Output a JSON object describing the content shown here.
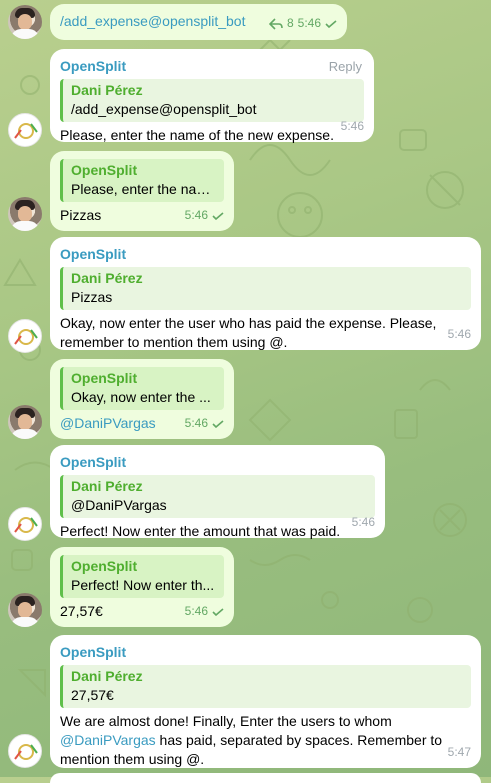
{
  "colors": {
    "background": "#a9c785",
    "outgoing_bubble": "#effdde",
    "incoming_bubble": "#ffffff",
    "sender_name": "#3a9bc0",
    "quote_bar": "#5fbf4a",
    "status_green": "#63a864"
  },
  "messages": [
    {
      "type": "outgoing",
      "text": "/add_expense@opensplit_bot",
      "reply_count": "8",
      "time": "5:46"
    },
    {
      "type": "incoming",
      "sender": "OpenSplit",
      "reply_label": "Reply",
      "quote_name": "Dani Pérez",
      "quote_text": "/add_expense@opensplit_bot",
      "text": "Please, enter the name of the new expense.",
      "time": "5:46"
    },
    {
      "type": "outgoing",
      "quote_name": "OpenSplit",
      "quote_text": "Please, enter the nam...",
      "text": "Pizzas",
      "time": "5:46"
    },
    {
      "type": "incoming",
      "sender": "OpenSplit",
      "quote_name": "Dani Pérez",
      "quote_text": "Pizzas",
      "text_line1": "Okay, now enter the user who has paid the expense. Please,",
      "text_line2": "remember to mention them using @.",
      "time": "5:46"
    },
    {
      "type": "outgoing",
      "quote_name": "OpenSplit",
      "quote_text": "Okay, now enter the ...",
      "text": "@DaniPVargas",
      "time": "5:46"
    },
    {
      "type": "incoming",
      "sender": "OpenSplit",
      "quote_name": "Dani Pérez",
      "quote_text": "@DaniPVargas",
      "text": "Perfect! Now enter the amount that was paid.",
      "time": "5:46"
    },
    {
      "type": "outgoing",
      "quote_name": "OpenSplit",
      "quote_text": "Perfect! Now enter th...",
      "text": "27,57€",
      "time": "5:46"
    },
    {
      "type": "incoming",
      "sender": "OpenSplit",
      "quote_name": "Dani Pérez",
      "quote_text": "27,57€",
      "text_line1": "We are almost done! Finally, Enter the users to whom",
      "mention": "@DaniPVargas",
      "text_line2_rest": " has paid, separated by spaces. Remember to",
      "text_line3": "mention them using @.",
      "time": "5:47"
    }
  ]
}
